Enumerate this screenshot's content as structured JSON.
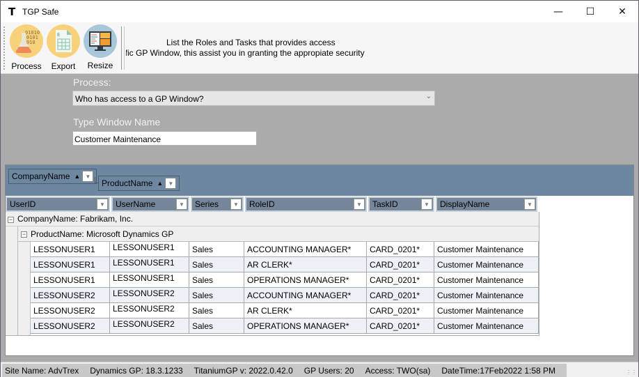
{
  "window": {
    "title": "TGP Safe",
    "app_icon_glyph": "T",
    "controls": {
      "minimize": "—",
      "maximize": "☐",
      "close": "✕"
    }
  },
  "toolbar": {
    "buttons": [
      {
        "label": "Process",
        "icon": "flask-binary-icon",
        "color": "#f7d27a"
      },
      {
        "label": "Export",
        "icon": "spreadsheet-icon",
        "color": "#f7d27a"
      },
      {
        "label": "Resize",
        "icon": "monitor-icon",
        "color": "#a9c7d8"
      }
    ],
    "description_line1": "List the Roles and Tasks that provides access",
    "description_line2": "ific GP Window, this assist you in granting the appropiate security "
  },
  "form": {
    "process_label": "Process:",
    "process_value": "Who has access to a GP Window?",
    "window_name_label": "Type Window Name",
    "window_name_value": "Customer Maintenance"
  },
  "grid": {
    "group_by": [
      {
        "label": "CompanyName",
        "sort": "▲"
      },
      {
        "label": "ProductName",
        "sort": "▲"
      }
    ],
    "columns": [
      "UserID",
      "UserName",
      "Series",
      "RoleID",
      "TaskID",
      "DisplayName"
    ],
    "group1_label": "CompanyName: Fabrikam, Inc.",
    "group2_label": "ProductName: Microsoft Dynamics GP",
    "rows": [
      [
        "LESSONUSER1",
        "LESSONUSER1",
        "Sales",
        "ACCOUNTING MANAGER*",
        "CARD_0201*",
        "Customer Maintenance"
      ],
      [
        "LESSONUSER1",
        "LESSONUSER1",
        "Sales",
        "AR CLERK*",
        "CARD_0201*",
        "Customer Maintenance"
      ],
      [
        "LESSONUSER1",
        "LESSONUSER1",
        "Sales",
        "OPERATIONS MANAGER*",
        "CARD_0201*",
        "Customer Maintenance"
      ],
      [
        "LESSONUSER2",
        "LESSONUSER2",
        "Sales",
        "ACCOUNTING MANAGER*",
        "CARD_0201*",
        "Customer Maintenance"
      ],
      [
        "LESSONUSER2",
        "LESSONUSER2",
        "Sales",
        "AR CLERK*",
        "CARD_0201*",
        "Customer Maintenance"
      ],
      [
        "LESSONUSER2",
        "LESSONUSER2",
        "Sales",
        "OPERATIONS MANAGER*",
        "CARD_0201*",
        "Customer Maintenance"
      ]
    ]
  },
  "status": {
    "site": "Site Name: AdvTrex",
    "dynamics": "Dynamics GP: 18.3.1233",
    "titanium": "TitaniumGP v: 2022.0.42.0",
    "users": "GP Users: 20",
    "access": "Access: TWO(sa)",
    "datetime": "DateTime:17Feb2022 1:58 PM"
  }
}
